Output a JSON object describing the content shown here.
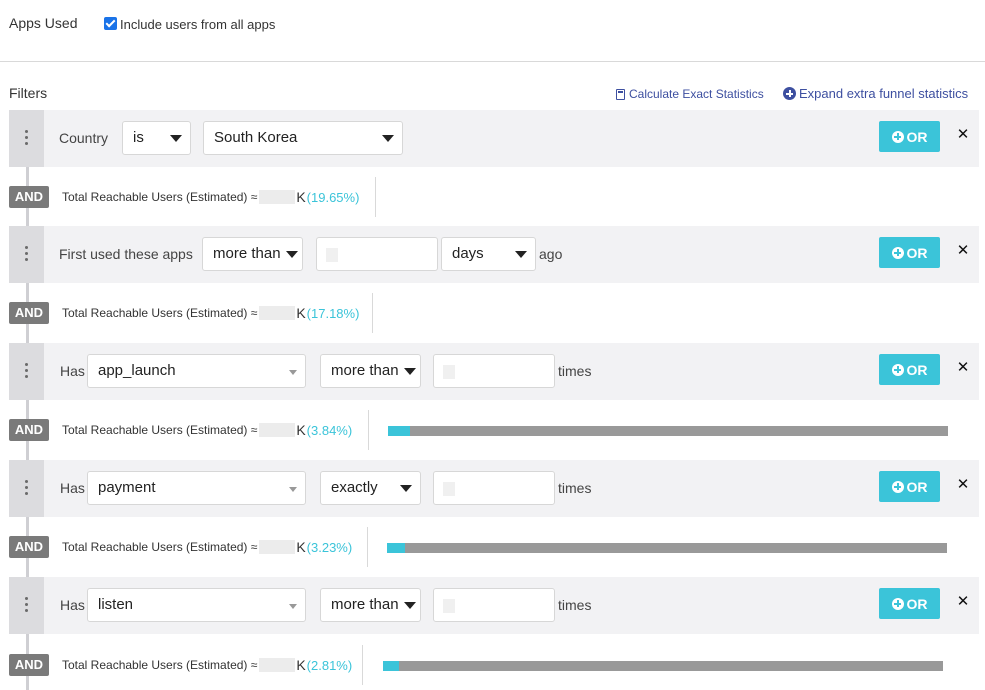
{
  "apps_used": {
    "title": "Apps Used",
    "include_all_checked": true,
    "include_all_label": "Include users from all apps"
  },
  "filters": {
    "title": "Filters",
    "calc_exact_label": "Calculate Exact Statistics",
    "expand_funnel_label": "Expand extra funnel statistics",
    "or_label": "OR",
    "and_label": "AND",
    "close_glyph": "✕",
    "reach_label": "Total Reachable Users (Estimated) ≈",
    "reach_unit": "K"
  },
  "rows": [
    {
      "label": "Country",
      "operator": "is",
      "value": "South Korea"
    },
    {
      "label": "First used these apps",
      "comparison": "more than",
      "unit": "days",
      "suffix": "ago"
    },
    {
      "label": "Has",
      "event": "app_launch",
      "comparison": "more than",
      "suffix": "times"
    },
    {
      "label": "Has",
      "event": "payment",
      "comparison": "exactly",
      "suffix": "times"
    },
    {
      "label": "Has",
      "event": "listen",
      "comparison": "more than",
      "suffix": "times"
    }
  ],
  "stats": [
    {
      "percent_label": "(19.65%)",
      "percent": 19.65,
      "bar": false
    },
    {
      "percent_label": "(17.18%)",
      "percent": 17.18,
      "bar": false
    },
    {
      "percent_label": "(3.84%)",
      "percent": 3.84,
      "bar": true
    },
    {
      "percent_label": "(3.23%)",
      "percent": 3.23,
      "bar": true
    },
    {
      "percent_label": "(2.81%)",
      "percent": 2.81,
      "bar": true
    }
  ],
  "colors": {
    "accent": "#3bc4d9",
    "link": "#3d4fa0",
    "and_badge": "#7a7a7a",
    "bar_track": "#999999"
  }
}
